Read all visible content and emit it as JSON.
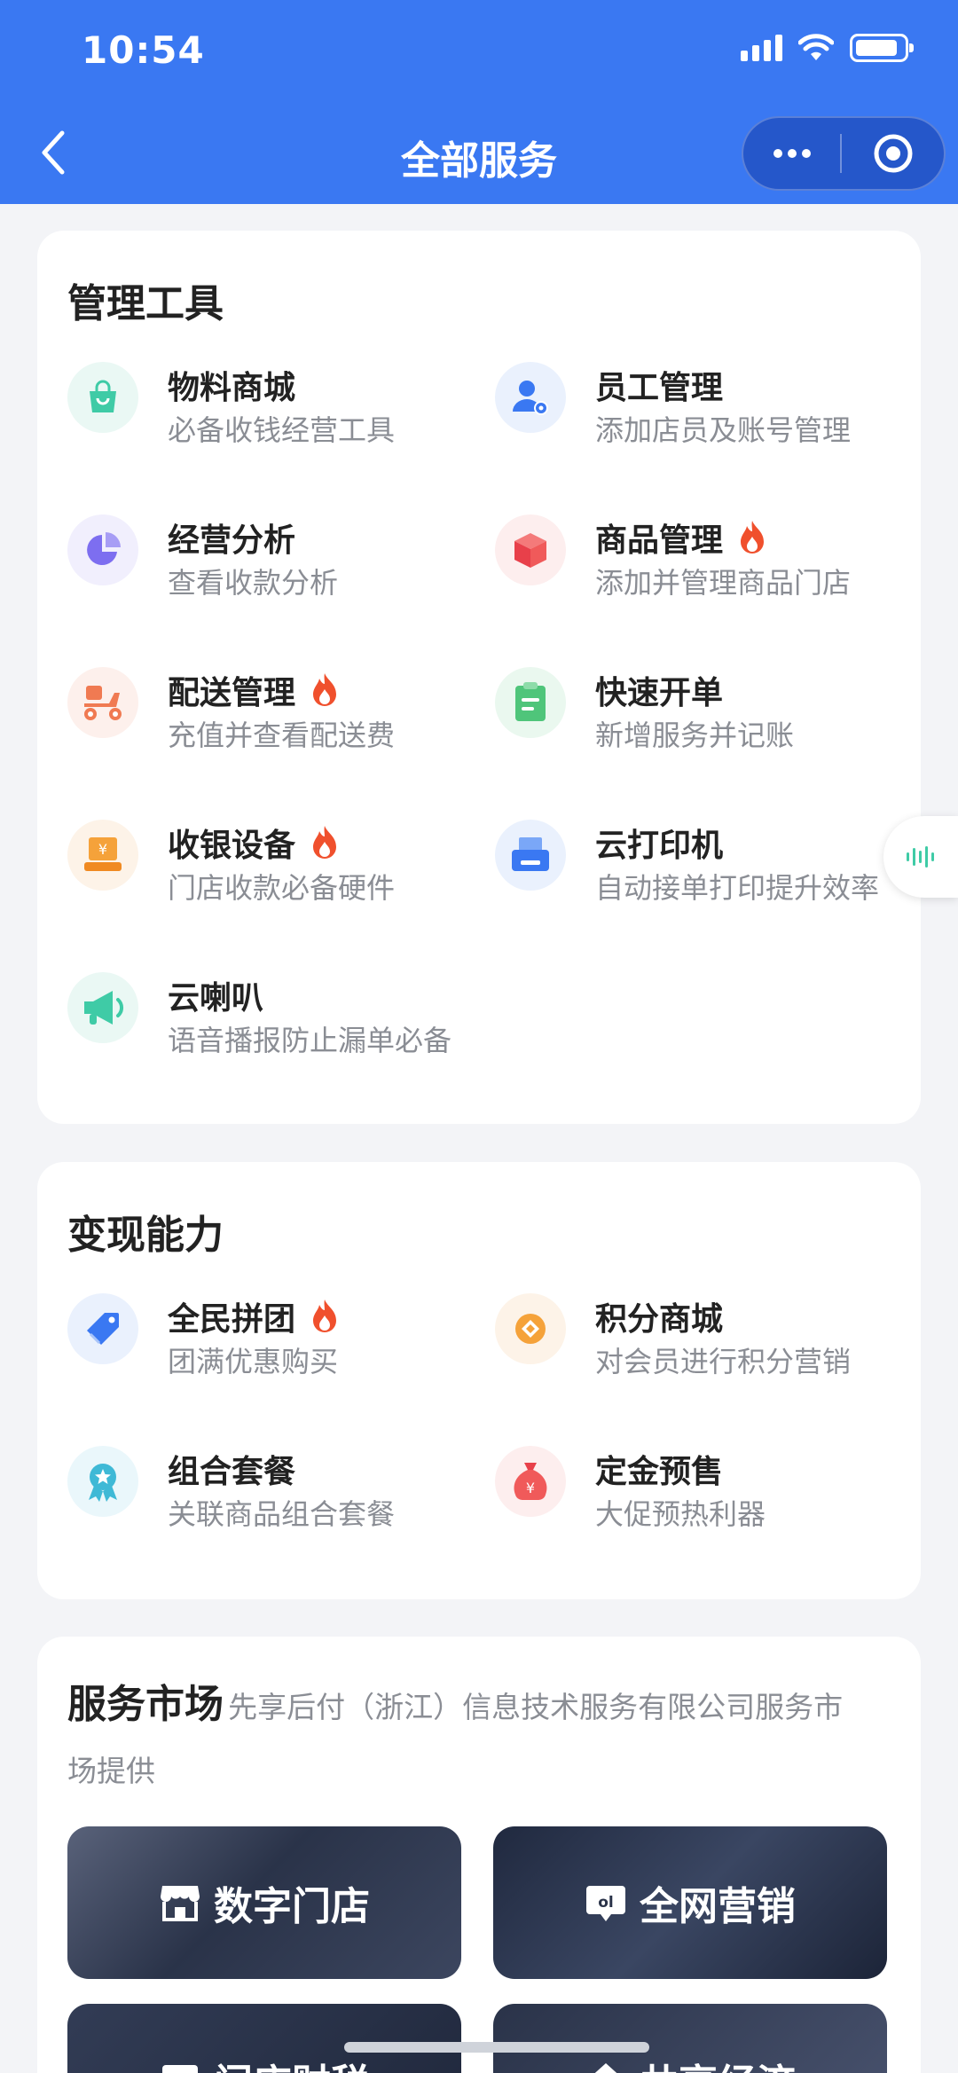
{
  "status_bar": {
    "time": "10:54"
  },
  "nav": {
    "title": "全部服务"
  },
  "management": {
    "title": "管理工具",
    "items": [
      {
        "name": "物料商城",
        "desc": "必备收钱经营工具",
        "hot": false,
        "icon": "bag-icon"
      },
      {
        "name": "员工管理",
        "desc": "添加店员及账号管理",
        "hot": false,
        "icon": "staff-settings-icon"
      },
      {
        "name": "经营分析",
        "desc": "查看收款分析",
        "hot": false,
        "icon": "pie-chart-icon"
      },
      {
        "name": "商品管理",
        "desc": "添加并管理商品门店",
        "hot": true,
        "icon": "box-icon"
      },
      {
        "name": "配送管理",
        "desc": "充值并查看配送费",
        "hot": true,
        "icon": "scooter-icon"
      },
      {
        "name": "快速开单",
        "desc": "新增服务并记账",
        "hot": false,
        "icon": "clipboard-icon"
      },
      {
        "name": "收银设备",
        "desc": "门店收款必备硬件",
        "hot": true,
        "icon": "cash-register-icon"
      },
      {
        "name": "云打印机",
        "desc": "自动接单打印提升效率",
        "hot": false,
        "icon": "printer-icon"
      },
      {
        "name": "云喇叭",
        "desc": "语音播报防止漏单必备",
        "hot": false,
        "icon": "megaphone-icon"
      }
    ]
  },
  "monetize": {
    "title": "变现能力",
    "items": [
      {
        "name": "全民拼团",
        "desc": "团满优惠购买",
        "hot": true,
        "icon": "tag-icon"
      },
      {
        "name": "积分商城",
        "desc": "对会员进行积分营销",
        "hot": false,
        "icon": "points-icon"
      },
      {
        "name": "组合套餐",
        "desc": "关联商品组合套餐",
        "hot": false,
        "icon": "badge-icon"
      },
      {
        "name": "定金预售",
        "desc": "大促预热利器",
        "hot": false,
        "icon": "money-bag-icon"
      }
    ]
  },
  "market": {
    "title": "服务市场",
    "subtitle_line1": "先享后付（浙江）信息技术服务有限公司服务市",
    "subtitle_line2": "场提供",
    "tiles": [
      {
        "label": "数字门店",
        "icon": "store-icon"
      },
      {
        "label": "全网营销",
        "icon": "ad-icon"
      },
      {
        "label": "门店财税",
        "icon": "finance-icon"
      },
      {
        "label": "共享经济",
        "icon": "share-icon"
      }
    ]
  },
  "colors": {
    "brand_blue": "#3a78f2",
    "hot_red": "#f0502d"
  }
}
